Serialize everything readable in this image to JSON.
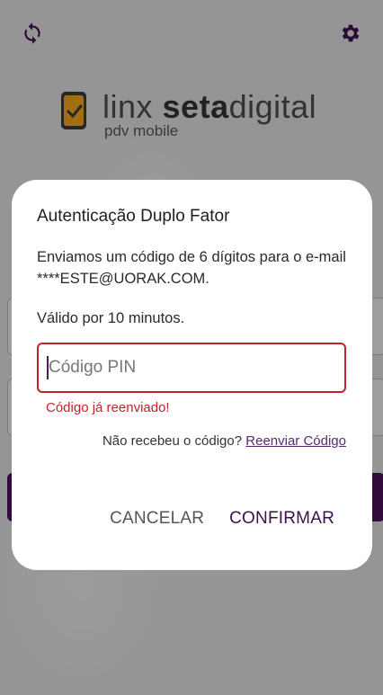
{
  "app": {
    "logo_word_light_1": "linx ",
    "logo_word_bold": "seta",
    "logo_word_light_2": "digital",
    "logo_sub": "pdv mobile",
    "icons": {
      "sync": "sync-icon",
      "settings": "gear-icon"
    },
    "colors": {
      "primary": "#4b0f5c",
      "error": "#c0232c"
    }
  },
  "dialog": {
    "title": "Autenticação Duplo Fator",
    "message": "Enviamos um código de 6 dígitos para o e-mail ****ESTE@UORAK.COM.",
    "validity": "Válido por 10 minutos.",
    "pin_placeholder": "Código PIN",
    "pin_value": "",
    "error": "Código já reenviado!",
    "resend_prompt": "Não recebeu o código?",
    "resend_link": "Reenviar Código",
    "cancel_label": "CANCELAR",
    "confirm_label": "CONFIRMAR"
  }
}
